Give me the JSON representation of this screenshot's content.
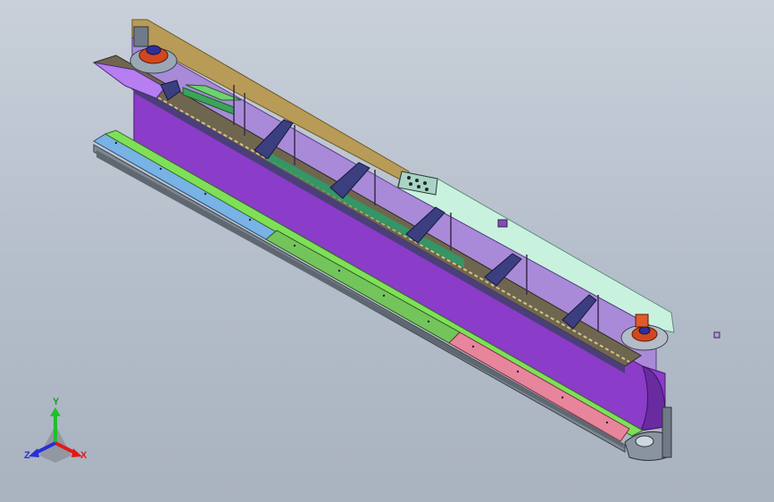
{
  "viewport": {
    "background_top": "#c9d0da",
    "background_bottom": "#a9b2bf"
  },
  "model": {
    "description_colors": {
      "web": "#8a3cc6",
      "top_rail_left": "#b79a55",
      "top_rail_right": "#c8f0dc",
      "front_strip_a": "#7ab0e0",
      "front_strip_b": "#7ed15a",
      "front_strip_c": "#e6849b",
      "brackets": "#3a3f7a"
    }
  },
  "triad": {
    "x_label": "X",
    "y_label": "Y",
    "z_label": "Z",
    "x_color": "#e01b1b",
    "y_color": "#1fbf2a",
    "z_color": "#2630d6"
  }
}
